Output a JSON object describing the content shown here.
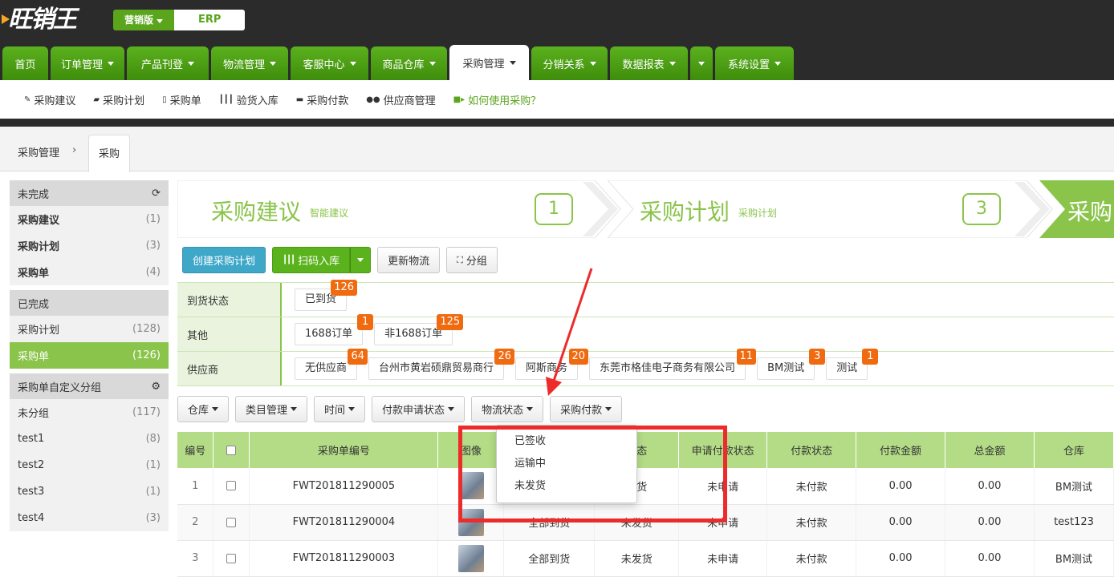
{
  "brand": {
    "logo_text": "旺销王",
    "edition_label": "营销版",
    "product_label": "ERP"
  },
  "main_nav": [
    {
      "label": "首页",
      "caret": false,
      "active": false
    },
    {
      "label": "订单管理",
      "caret": true,
      "active": false
    },
    {
      "label": "产品刊登",
      "caret": true,
      "active": false
    },
    {
      "label": "物流管理",
      "caret": true,
      "active": false
    },
    {
      "label": "客服中心",
      "caret": true,
      "active": false
    },
    {
      "label": "商品仓库",
      "caret": true,
      "active": false
    },
    {
      "label": "采购管理",
      "caret": true,
      "active": true
    },
    {
      "label": "分销关系",
      "caret": true,
      "active": false
    },
    {
      "label": "数据报表",
      "caret": true,
      "active": false
    },
    {
      "label": "",
      "caret": true,
      "active": false
    },
    {
      "label": "系统设置",
      "caret": true,
      "active": false
    }
  ],
  "sub_nav": [
    {
      "label": "采购建议",
      "icon": "magic-wand-icon",
      "glyph": "✎"
    },
    {
      "label": "采购计划",
      "icon": "book-icon",
      "glyph": "▰"
    },
    {
      "label": "采购单",
      "icon": "file-icon",
      "glyph": "▯"
    },
    {
      "label": "验货入库",
      "icon": "barcode-icon",
      "glyph": "┃┃┃"
    },
    {
      "label": "采购付款",
      "icon": "credit-card-icon",
      "glyph": "▬"
    },
    {
      "label": "供应商管理",
      "icon": "users-icon",
      "glyph": "●●"
    },
    {
      "label": "如何使用采购？",
      "icon": "video-camera-icon",
      "glyph": "■▸"
    }
  ],
  "breadcrumb": {
    "root": "采购管理",
    "separator": "›",
    "tab": "采购"
  },
  "sidebar": {
    "groups": [
      {
        "title": "未完成",
        "icon": "refresh-icon",
        "icon_glyph": "⟳",
        "rows": [
          {
            "label": "采购建议",
            "count": "(1)",
            "bold": true,
            "selected": false
          },
          {
            "label": "采购计划",
            "count": "(3)",
            "bold": true,
            "selected": false
          },
          {
            "label": "采购单",
            "count": "(4)",
            "bold": true,
            "selected": false
          }
        ]
      },
      {
        "title": "已完成",
        "icon": "",
        "icon_glyph": "",
        "rows": [
          {
            "label": "采购计划",
            "count": "(128)",
            "bold": false,
            "selected": false
          },
          {
            "label": "采购单",
            "count": "(126)",
            "bold": false,
            "selected": true
          }
        ]
      },
      {
        "title": "采购单自定义分组",
        "icon": "gear-icon",
        "icon_glyph": "⚙",
        "rows": [
          {
            "label": "未分组",
            "count": "(117)",
            "bold": false,
            "selected": false
          },
          {
            "label": "test1",
            "count": "(8)",
            "bold": false,
            "selected": false
          },
          {
            "label": "test2",
            "count": "(1)",
            "bold": false,
            "selected": false
          },
          {
            "label": "test3",
            "count": "(1)",
            "bold": false,
            "selected": false
          },
          {
            "label": "test4",
            "count": "(3)",
            "bold": false,
            "selected": false
          }
        ]
      }
    ]
  },
  "steps": [
    {
      "title": "采购建议",
      "sub": "智能建议",
      "num": "1"
    },
    {
      "title": "采购计划",
      "sub": "采购计划",
      "num": "3"
    },
    {
      "title": "采购",
      "sub": "",
      "num": ""
    }
  ],
  "buttons": {
    "create_plan": "创建采购计划",
    "scan_in": "扫码入库",
    "update_logistics": "更新物流",
    "group": "分组"
  },
  "filters": [
    {
      "label": "到货状态",
      "chips": [
        {
          "text": "已到货",
          "badge": "126"
        }
      ]
    },
    {
      "label": "其他",
      "chips": [
        {
          "text": "1688订单",
          "badge": "1"
        },
        {
          "text": "非1688订单",
          "badge": "125"
        }
      ]
    },
    {
      "label": "供应商",
      "chips": [
        {
          "text": "无供应商",
          "badge": "64"
        },
        {
          "text": "台州市黄岩硕鼎贸易商行",
          "badge": "26"
        },
        {
          "text": "阿斯商务",
          "badge": "20"
        },
        {
          "text": "东莞市格佳电子商务有限公司",
          "badge": "11"
        },
        {
          "text": "BM测试",
          "badge": "3"
        },
        {
          "text": "测试",
          "badge": "1"
        }
      ]
    }
  ],
  "dropdowns": [
    "仓库",
    "类目管理",
    "时间",
    "付款申请状态",
    "物流状态",
    "采购付款"
  ],
  "table": {
    "headers": [
      "编号",
      "",
      "采购单编号",
      "图像",
      "",
      "状态",
      "申请付款状态",
      "付款状态",
      "付款金额",
      "总金额",
      "仓库"
    ],
    "rows": [
      [
        "1",
        "",
        "FWT201811290005",
        "",
        "",
        "发货",
        "未申请",
        "未付款",
        "0.00",
        "0.00",
        "BM测试"
      ],
      [
        "2",
        "",
        "FWT201811290004",
        "",
        "全部到货",
        "未发货",
        "未申请",
        "未付款",
        "0.00",
        "0.00",
        "test123"
      ],
      [
        "3",
        "",
        "FWT201811290003",
        "",
        "全部到货",
        "未发货",
        "未申请",
        "未付款",
        "0.00",
        "0.00",
        "BM测试"
      ]
    ]
  },
  "logistics_menu": {
    "items": [
      "已签收",
      "运输中",
      "未发货"
    ]
  },
  "colors": {
    "brand_green": "#5aa51c",
    "accent_green": "#8ac44a",
    "badge_orange": "#f06a10",
    "annotation_red": "#ee2b2b",
    "info_blue": "#3fa8c9"
  }
}
